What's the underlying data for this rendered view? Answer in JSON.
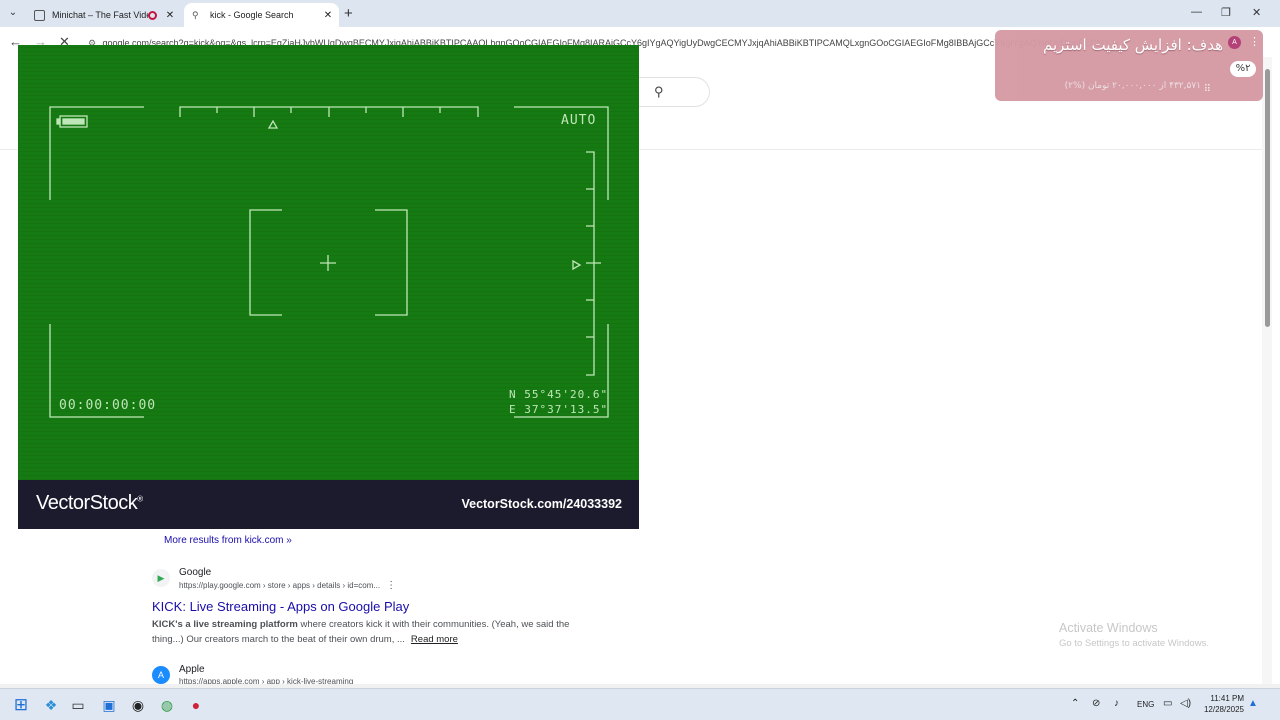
{
  "browser": {
    "tabs": [
      {
        "title": "Minichat – The Fast Video C"
      },
      {
        "title": "kick - Google Search"
      }
    ],
    "new_tab_label": "+",
    "url": "google.com/search?q=kick&oq=&gs_lcrp=EgZjaHJvbWUqDwgBECMYJxjqAhiABBiKBTIPCAAQLhgnGOoCGIAEGIoFMg8IARAjGCcY6gIYgAQYigUyDwgCECMYJxjqAhiABBiKBTIPCAMQLxgnGOoCGIAEGIoFMg8IBBAjGCcY6gIYgAQYigUyDwgFECMYJxjqAhiA",
    "window_controls": {
      "minimize": "—",
      "maximize": "❐",
      "close": "✕"
    }
  },
  "overlay": {
    "goal_text": "هدف: افزایش کیفیت استریم",
    "percent": "%۲",
    "progress_text": "۴۳۲,۵۷۱ از ۲۰,۰۰۰,۰۰۰ تومان (%۲)",
    "progress_fraction": 0.02,
    "avatar_letter": "A"
  },
  "video": {
    "auto_label": "AUTO",
    "timecode": "00:00:00:00",
    "coord_n": "N  55°45'20.6\"",
    "coord_e": "E  37°37'13.5\"",
    "brand": "VectorStock",
    "brand_mark": "®",
    "brand_url": "VectorStock.com/24033392"
  },
  "results": {
    "more_link": "More results from kick.com »",
    "items": [
      {
        "site_name": "Google",
        "site_url": "https://play.google.com › store › apps › details › id=com...",
        "title": "KICK: Live Streaming - Apps on Google Play",
        "snippet_bold": "KICK's a live streaming platform",
        "snippet_rest": " where creators kick it with their communities. (Yeah, we said the thing...) Our creators march to the beat of their own drum, ...",
        "read_more": "Read more"
      },
      {
        "site_name": "Apple",
        "site_url": "https://apps.apple.com › app › kick-live-streaming"
      }
    ]
  },
  "watermark": {
    "line1": "Activate Windows",
    "line2": "Go to Settings to activate Windows."
  },
  "taskbar": {
    "lang": "ENG",
    "time": "11:41 PM",
    "date": "12/28/2025"
  }
}
